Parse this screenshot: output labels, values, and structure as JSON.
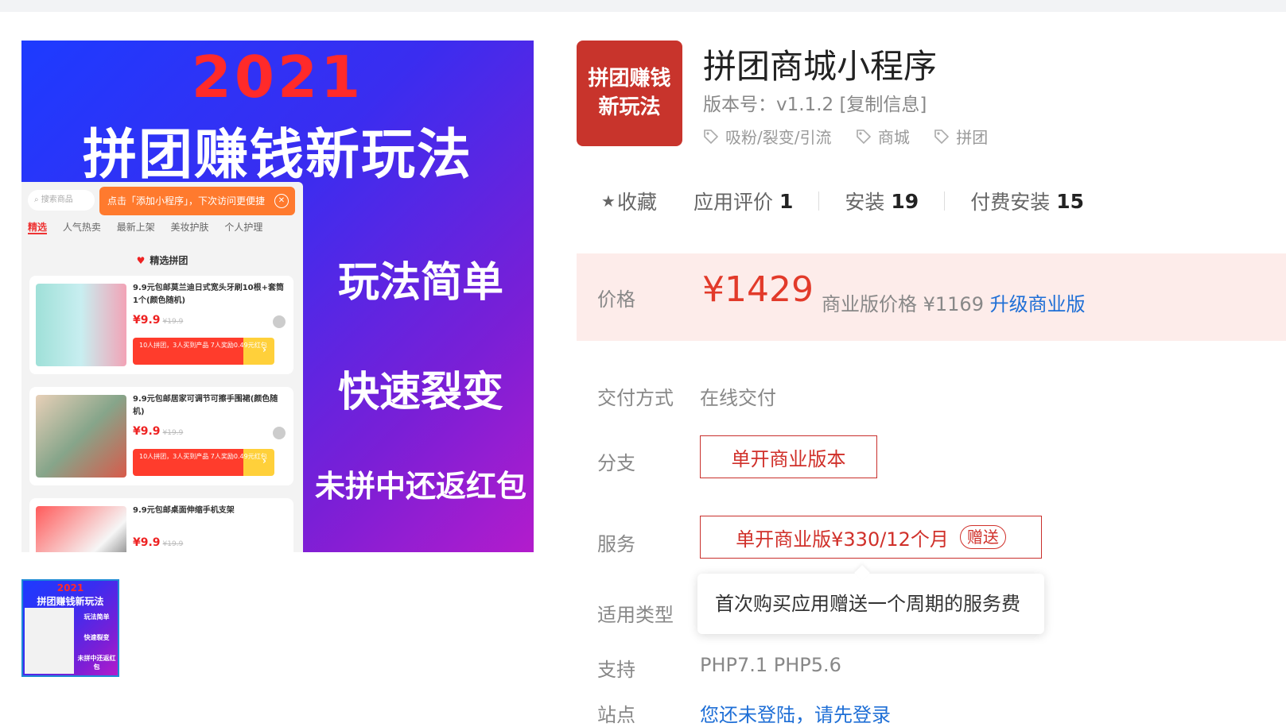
{
  "colors": {
    "accent_red": "#e23a2a",
    "link_blue": "#1f6fd6",
    "price_bg": "#fdecea",
    "icon_bg": "#c8342c"
  },
  "promo": {
    "year": "2021",
    "headline": "拼团赚钱新玩法",
    "side1": "玩法简单",
    "side2": "快速裂变",
    "side3": "未拼中还返红包",
    "phone": {
      "search_placeholder": "搜索商品",
      "toast": "点击「添加小程序」，下次访问更便捷",
      "tabs": [
        "精选",
        "人气热卖",
        "最新上架",
        "美妆护肤",
        "个人护理"
      ],
      "section": "精选拼团",
      "items": [
        {
          "title": "9.9元包邮莫兰迪日式宽头牙刷10根+套筒1个(颜色随机)",
          "price": "¥9.9",
          "old": "¥19.9",
          "bar": "10人拼团，3人买到产品 7人奖励0.49元红包"
        },
        {
          "title": "9.9元包邮居家可调节可擦手围裙(颜色随机)",
          "price": "¥9.9",
          "old": "¥19.9",
          "bar": "10人拼团，3人买到产品 7人奖励0.49元红包"
        },
        {
          "title": "9.9元包邮桌面伸缩手机支架",
          "price": "¥9.9",
          "old": "¥19.9"
        }
      ]
    }
  },
  "thumb": {
    "year": "2021",
    "headline": "拼团赚钱新玩法",
    "side": [
      "玩法简单",
      "快速裂变",
      "未拼中还返红包"
    ]
  },
  "app": {
    "icon_text_1": "拼团赚钱",
    "icon_text_2": "新玩法",
    "title": "拼团商城小程序",
    "version": "版本号：v1.1.2",
    "copy_info": "[复制信息]",
    "tags": [
      "吸粉/裂变/引流",
      "商城",
      "拼团"
    ]
  },
  "stats": {
    "favorite": "收藏",
    "reviews_label": "应用评价",
    "reviews": "1",
    "installs_label": "安装",
    "installs": "19",
    "paid_label": "付费安装",
    "paid": "15"
  },
  "price": {
    "label": "价格",
    "value": "¥1429",
    "biz_text": "商业版价格 ¥1169",
    "upgrade": "升级商业版"
  },
  "details": {
    "delivery_label": "交付方式",
    "delivery_value": "在线交付",
    "branch_label": "分支",
    "branch_button": "单开商业版本",
    "service_label": "服务",
    "service_button": "单开商业版¥330/12个月",
    "gift_badge": "赠送",
    "tooltip": "首次购买应用赠送一个周期的服务费",
    "type_label": "适用类型",
    "support_label": "支持",
    "support_value": "PHP7.1 PHP5.6",
    "site_label": "站点",
    "site_link": "您还未登陆，请先登录"
  }
}
